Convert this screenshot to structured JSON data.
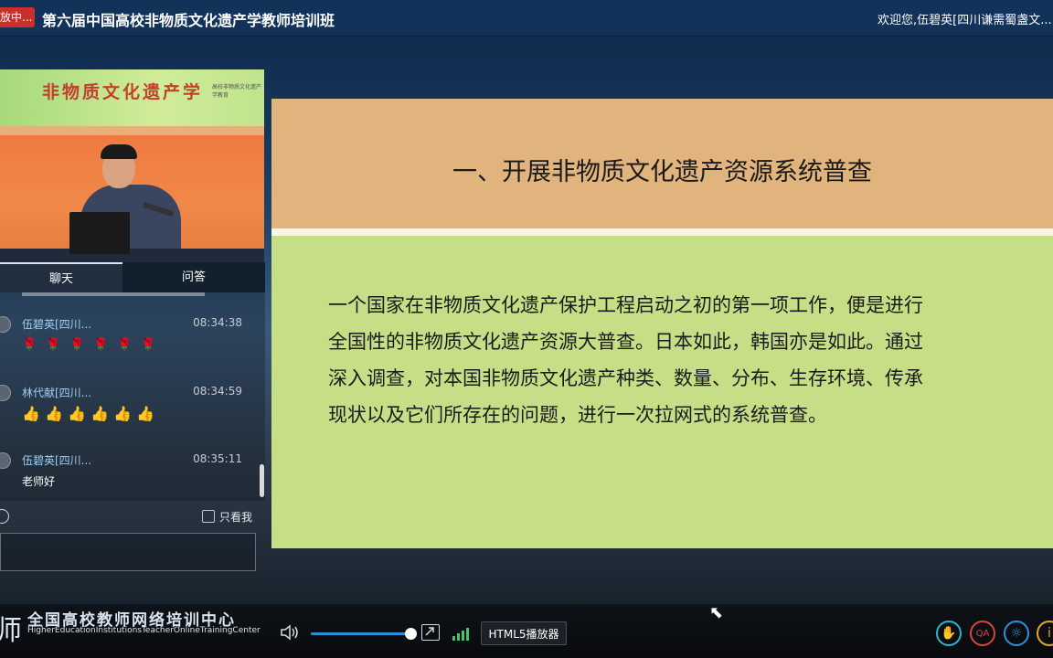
{
  "topbar": {
    "live_badge": "放中...",
    "course_title": "第六届中国高校非物质文化遗产学教师培训班",
    "welcome": "欢迎您,伍碧英[四川谦需蜀盏文..."
  },
  "video": {
    "banner_text": "非物质文化遗产学",
    "banner_sub": "高校非物质文化遗产学教育"
  },
  "chat": {
    "tab_chat": "聊天",
    "tab_qa": "问答",
    "messages": [
      {
        "name": "伍碧英[四川...",
        "time": "08:34:38",
        "body_emoji": [
          "🌹",
          "🌹",
          "🌹",
          "🌹",
          "🌹",
          "🌹"
        ]
      },
      {
        "name": "林代献[四川...",
        "time": "08:34:59",
        "body_emoji": [
          "👍",
          "👍",
          "👍",
          "👍",
          "👍",
          "👍"
        ]
      },
      {
        "name": "伍碧英[四川...",
        "time": "08:35:11",
        "body": "老师好"
      }
    ],
    "only_me_label": "只看我"
  },
  "slide": {
    "heading": "一、开展非物质文化遗产资源系统普查",
    "body_lines": [
      "一个国家在非物质文化遗产保护工程启动之初的第一项工作，便是进行",
      "全国性的非物质文化遗产资源大普查。日本如此，韩国亦是如此。通过",
      "深入调查，对本国非物质文化遗产种类、数量、分布、生存环境、传承",
      "现状以及它们所存在的问题，进行一次拉网式的系统普查。"
    ]
  },
  "bottombar": {
    "logo_char": "师",
    "logo_cn": "全国高校教师网络培训中心",
    "logo_en": "HigherEducationInstitutionsTeacherOnlineTrainingCenter",
    "player_label": "HTML5播放器",
    "volume_level": 0.95
  },
  "colors": {
    "slide_top": "#e0b47c",
    "slide_bottom": "#c6de86",
    "badge": "#c8302c",
    "accent_blue": "#2f8fd8"
  }
}
